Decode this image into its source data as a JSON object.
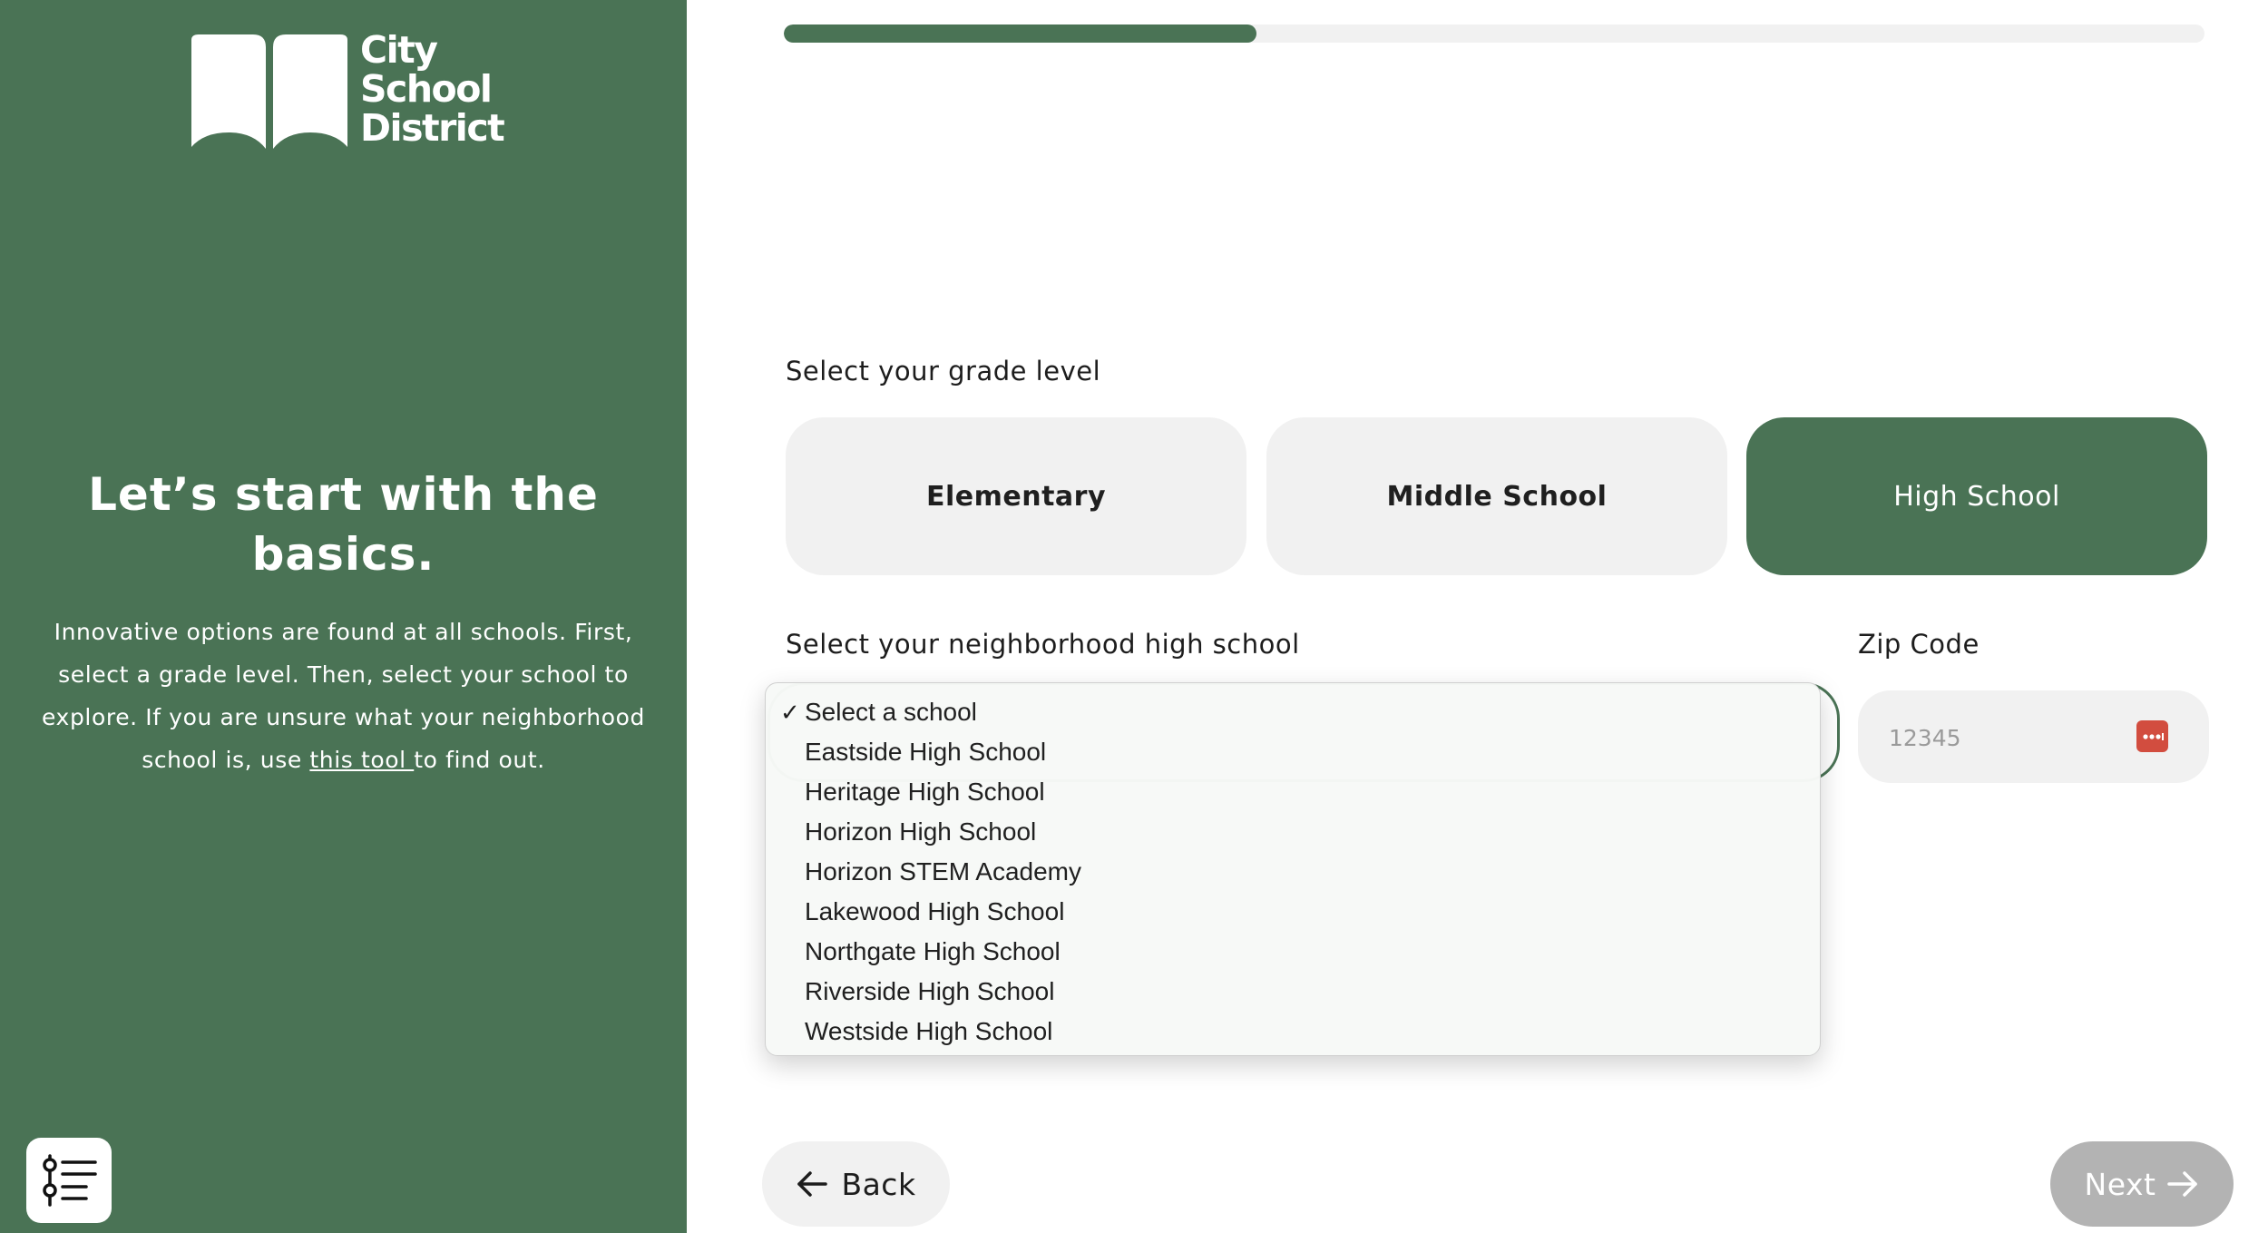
{
  "brand": {
    "logo_lines": [
      "City",
      "School",
      "District"
    ],
    "primary_color": "#4a7355"
  },
  "intro": {
    "headline": "Let’s start with the basics.",
    "body_before_link": "Innovative options are found at all schools. First, select a grade level. Then, select your school to explore. If you are unsure what your neighborhood school is, use ",
    "link_text": "this tool ",
    "body_after_link": "to find out."
  },
  "progress": {
    "fraction": 0.333
  },
  "grade": {
    "label": "Select your grade level",
    "options": [
      "Elementary",
      "Middle School",
      "High School"
    ],
    "selected": "High School"
  },
  "school_select": {
    "label": "Select your neighborhood high school",
    "selected": "Select a school",
    "options": [
      "Select a school",
      "Eastside High School",
      "Heritage High School",
      "Horizon High School",
      "Horizon STEM Academy",
      "Lakewood High School",
      "Northgate High School",
      "Riverside High School",
      "Westside High School"
    ]
  },
  "zip": {
    "label": "Zip Code",
    "placeholder": "12345",
    "value": "",
    "icon": "password-manager-icon"
  },
  "nav": {
    "back_label": "Back",
    "next_label": "Next"
  },
  "filter_icon": "filter-list-icon"
}
